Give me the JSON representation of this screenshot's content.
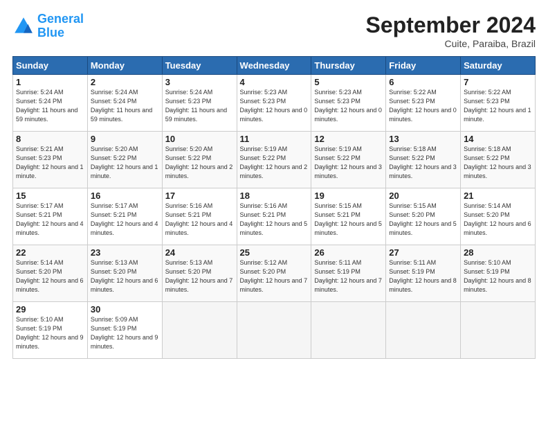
{
  "header": {
    "logo_line1": "General",
    "logo_line2": "Blue",
    "month": "September 2024",
    "location": "Cuite, Paraiba, Brazil"
  },
  "weekdays": [
    "Sunday",
    "Monday",
    "Tuesday",
    "Wednesday",
    "Thursday",
    "Friday",
    "Saturday"
  ],
  "days": [
    {
      "num": "",
      "info": ""
    },
    {
      "num": "",
      "info": ""
    },
    {
      "num": "",
      "info": ""
    },
    {
      "num": "",
      "info": ""
    },
    {
      "num": "",
      "info": ""
    },
    {
      "num": "",
      "info": ""
    },
    {
      "num": "1",
      "sunrise": "5:24 AM",
      "sunset": "5:24 PM",
      "daylight": "11 hours and 59 minutes."
    },
    {
      "num": "2",
      "sunrise": "5:24 AM",
      "sunset": "5:24 PM",
      "daylight": "11 hours and 59 minutes."
    },
    {
      "num": "3",
      "sunrise": "5:24 AM",
      "sunset": "5:23 PM",
      "daylight": "11 hours and 59 minutes."
    },
    {
      "num": "4",
      "sunrise": "5:23 AM",
      "sunset": "5:23 PM",
      "daylight": "12 hours and 0 minutes."
    },
    {
      "num": "5",
      "sunrise": "5:23 AM",
      "sunset": "5:23 PM",
      "daylight": "12 hours and 0 minutes."
    },
    {
      "num": "6",
      "sunrise": "5:22 AM",
      "sunset": "5:23 PM",
      "daylight": "12 hours and 0 minutes."
    },
    {
      "num": "7",
      "sunrise": "5:22 AM",
      "sunset": "5:23 PM",
      "daylight": "12 hours and 1 minute."
    },
    {
      "num": "8",
      "sunrise": "5:21 AM",
      "sunset": "5:23 PM",
      "daylight": "12 hours and 1 minute."
    },
    {
      "num": "9",
      "sunrise": "5:20 AM",
      "sunset": "5:22 PM",
      "daylight": "12 hours and 1 minute."
    },
    {
      "num": "10",
      "sunrise": "5:20 AM",
      "sunset": "5:22 PM",
      "daylight": "12 hours and 2 minutes."
    },
    {
      "num": "11",
      "sunrise": "5:19 AM",
      "sunset": "5:22 PM",
      "daylight": "12 hours and 2 minutes."
    },
    {
      "num": "12",
      "sunrise": "5:19 AM",
      "sunset": "5:22 PM",
      "daylight": "12 hours and 3 minutes."
    },
    {
      "num": "13",
      "sunrise": "5:18 AM",
      "sunset": "5:22 PM",
      "daylight": "12 hours and 3 minutes."
    },
    {
      "num": "14",
      "sunrise": "5:18 AM",
      "sunset": "5:22 PM",
      "daylight": "12 hours and 3 minutes."
    },
    {
      "num": "15",
      "sunrise": "5:17 AM",
      "sunset": "5:21 PM",
      "daylight": "12 hours and 4 minutes."
    },
    {
      "num": "16",
      "sunrise": "5:17 AM",
      "sunset": "5:21 PM",
      "daylight": "12 hours and 4 minutes."
    },
    {
      "num": "17",
      "sunrise": "5:16 AM",
      "sunset": "5:21 PM",
      "daylight": "12 hours and 4 minutes."
    },
    {
      "num": "18",
      "sunrise": "5:16 AM",
      "sunset": "5:21 PM",
      "daylight": "12 hours and 5 minutes."
    },
    {
      "num": "19",
      "sunrise": "5:15 AM",
      "sunset": "5:21 PM",
      "daylight": "12 hours and 5 minutes."
    },
    {
      "num": "20",
      "sunrise": "5:15 AM",
      "sunset": "5:20 PM",
      "daylight": "12 hours and 5 minutes."
    },
    {
      "num": "21",
      "sunrise": "5:14 AM",
      "sunset": "5:20 PM",
      "daylight": "12 hours and 6 minutes."
    },
    {
      "num": "22",
      "sunrise": "5:14 AM",
      "sunset": "5:20 PM",
      "daylight": "12 hours and 6 minutes."
    },
    {
      "num": "23",
      "sunrise": "5:13 AM",
      "sunset": "5:20 PM",
      "daylight": "12 hours and 6 minutes."
    },
    {
      "num": "24",
      "sunrise": "5:13 AM",
      "sunset": "5:20 PM",
      "daylight": "12 hours and 7 minutes."
    },
    {
      "num": "25",
      "sunrise": "5:12 AM",
      "sunset": "5:20 PM",
      "daylight": "12 hours and 7 minutes."
    },
    {
      "num": "26",
      "sunrise": "5:11 AM",
      "sunset": "5:19 PM",
      "daylight": "12 hours and 7 minutes."
    },
    {
      "num": "27",
      "sunrise": "5:11 AM",
      "sunset": "5:19 PM",
      "daylight": "12 hours and 8 minutes."
    },
    {
      "num": "28",
      "sunrise": "5:10 AM",
      "sunset": "5:19 PM",
      "daylight": "12 hours and 8 minutes."
    },
    {
      "num": "29",
      "sunrise": "5:10 AM",
      "sunset": "5:19 PM",
      "daylight": "12 hours and 9 minutes."
    },
    {
      "num": "30",
      "sunrise": "5:09 AM",
      "sunset": "5:19 PM",
      "daylight": "12 hours and 9 minutes."
    },
    {
      "num": "",
      "info": ""
    },
    {
      "num": "",
      "info": ""
    },
    {
      "num": "",
      "info": ""
    },
    {
      "num": "",
      "info": ""
    },
    {
      "num": "",
      "info": ""
    }
  ]
}
